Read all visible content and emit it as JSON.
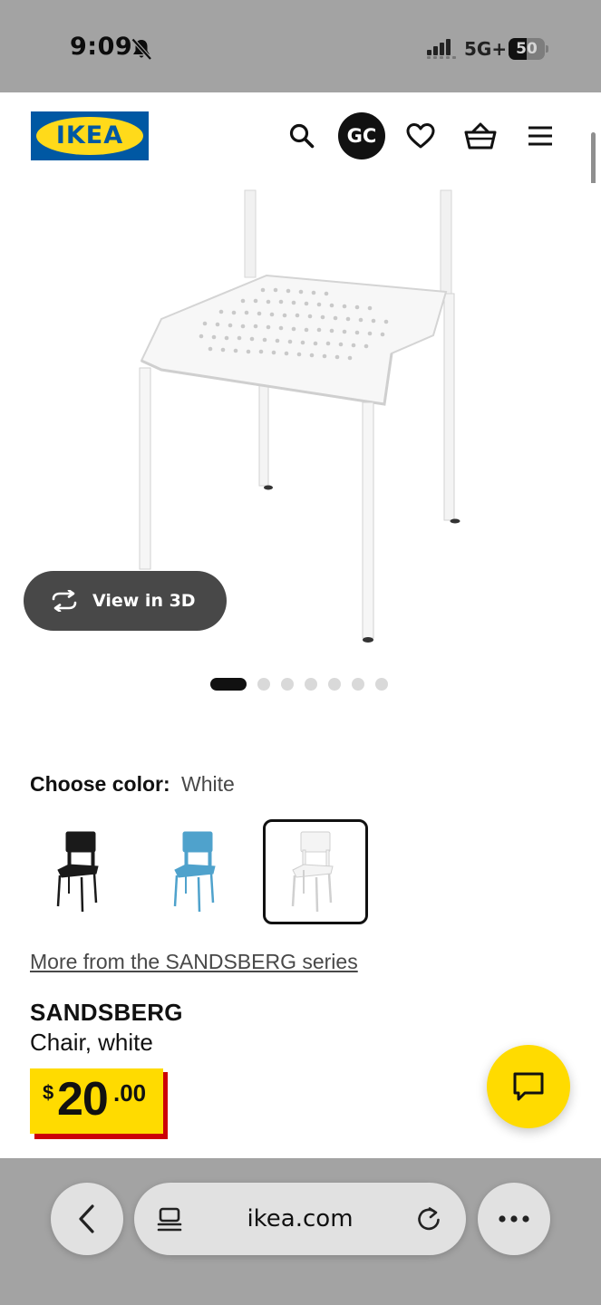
{
  "status_bar": {
    "time": "9:09",
    "network": "5G+",
    "battery_level": "50",
    "battery_fraction": 0.5
  },
  "header": {
    "logo_text": "IKEA",
    "avatar_initials": "GC"
  },
  "gallery": {
    "view_3d_label": "View in 3D",
    "slide_count": 7,
    "active_slide": 1
  },
  "color_picker": {
    "heading": "Choose color:",
    "selected_value": "White",
    "swatch_colors": [
      "#1a1a1a",
      "#4fa2cc",
      "#f4f4f4"
    ]
  },
  "series_link": "More from the SANDSBERG series",
  "product": {
    "name": "SANDSBERG",
    "description": "Chair, white"
  },
  "price": {
    "currency": "$",
    "integer": "20",
    "decimals": ".00"
  },
  "browser": {
    "url": "ikea.com"
  },
  "colors": {
    "ikea_blue": "#0058a3",
    "ikea_yellow": "#ffdb00",
    "price_red": "#cc0008"
  }
}
